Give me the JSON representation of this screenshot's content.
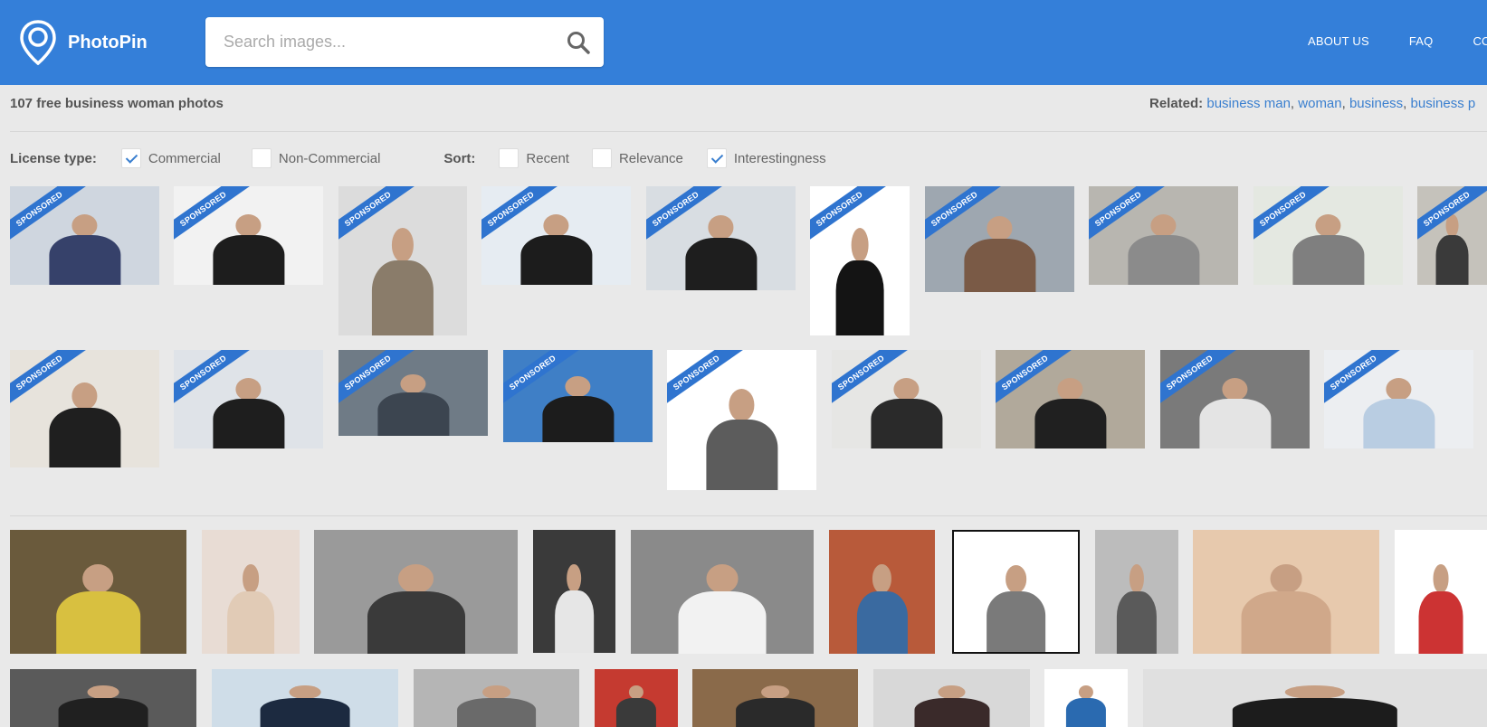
{
  "header": {
    "brand": "PhotoPin",
    "search_placeholder": "Search images...",
    "nav": [
      "ABOUT US",
      "FAQ",
      "CO"
    ]
  },
  "results": {
    "count_text": "107 free business woman photos",
    "related_label": "Related:",
    "related_links": [
      "business man",
      "woman",
      "business",
      "business p"
    ]
  },
  "filters": {
    "license_label": "License type:",
    "license": [
      {
        "label": "Commercial",
        "checked": true
      },
      {
        "label": "Non-Commercial",
        "checked": false
      }
    ],
    "sort_label": "Sort:",
    "sort": [
      {
        "label": "Recent",
        "checked": false
      },
      {
        "label": "Relevance",
        "checked": false
      },
      {
        "label": "Interestingness",
        "checked": true
      }
    ]
  },
  "sponsored_label": "SPONSORED",
  "photos": {
    "sponsored_row1": [
      {
        "bg": "#cfd6df",
        "figure": "#36416a"
      },
      {
        "bg": "#f2f2f2",
        "figure": "#1d1d1d"
      },
      {
        "bg": "#dcdcdc",
        "figure": "#8a7c6a"
      },
      {
        "bg": "#e6ecf2",
        "figure": "#1c1c1c"
      },
      {
        "bg": "#d8dde2",
        "figure": "#1e1e1e"
      },
      {
        "bg": "#ffffff",
        "figure": "#141414"
      },
      {
        "bg": "#9ea7b0",
        "figure": "#7a5a46"
      },
      {
        "bg": "#b8b6b0",
        "figure": "#8b8b8b"
      },
      {
        "bg": "#e4e8e1",
        "figure": "#7f7f7f"
      },
      {
        "bg": "#c5c2bb",
        "figure": "#3a3a3a"
      }
    ],
    "sponsored_row2": [
      {
        "bg": "#e7e3dc",
        "figure": "#1f1f1f"
      },
      {
        "bg": "#dfe3e8",
        "figure": "#1e1e1e"
      },
      {
        "bg": "#6f7b86",
        "figure": "#3c4550"
      },
      {
        "bg": "#3f7fc6",
        "figure": "#1c1c1c"
      },
      {
        "bg": "#ffffff",
        "figure": "#5c5c5c"
      },
      {
        "bg": "#e6e6e4",
        "figure": "#2a2a2a"
      },
      {
        "bg": "#b1a99b",
        "figure": "#202020"
      },
      {
        "bg": "#7a7a7a",
        "figure": "#e4e4e4"
      },
      {
        "bg": "#eceef1",
        "figure": "#b9cde2"
      }
    ],
    "free_row1": [
      {
        "bg": "#6a5a3c",
        "figure": "#d8c040"
      },
      {
        "bg": "#e8dcd4",
        "figure": "#e1cbb6"
      },
      {
        "bg": "#9a9a9a",
        "figure": "#3a3a3a"
      },
      {
        "bg": "#3a3a3a",
        "figure": "#e6e6e6"
      },
      {
        "bg": "#8a8a8a",
        "figure": "#f2f2f2"
      },
      {
        "bg": "#b85a3a",
        "figure": "#3a6aa0"
      },
      {
        "bg": "#ffffff",
        "figure": "#7a7a7a"
      },
      {
        "bg": "#bcbcbc",
        "figure": "#5a5a5a"
      },
      {
        "bg": "#e7c9ad",
        "figure": "#d0a88a"
      },
      {
        "bg": "#ffffff",
        "figure": "#cc3333"
      }
    ],
    "free_row2": [
      {
        "bg": "#5a5a5a",
        "figure": "#202020"
      },
      {
        "bg": "#cfdde8",
        "figure": "#1c2a40"
      },
      {
        "bg": "#b5b5b5",
        "figure": "#6a6a6a"
      },
      {
        "bg": "#c53a30",
        "figure": "#3a3a3a"
      },
      {
        "bg": "#8a6a4a",
        "figure": "#2a2a2a"
      },
      {
        "bg": "#d8d8d8",
        "figure": "#3a2a2a"
      },
      {
        "bg": "#ffffff",
        "figure": "#2a6ab0"
      },
      {
        "bg": "#e0e0e0",
        "figure": "#1c1c1c"
      }
    ]
  },
  "colors": {
    "header_blue": "#347fd9",
    "link_blue": "#3a7fcf",
    "ribbon_blue": "#2f74cf",
    "page_bg": "#e9e9e9"
  }
}
